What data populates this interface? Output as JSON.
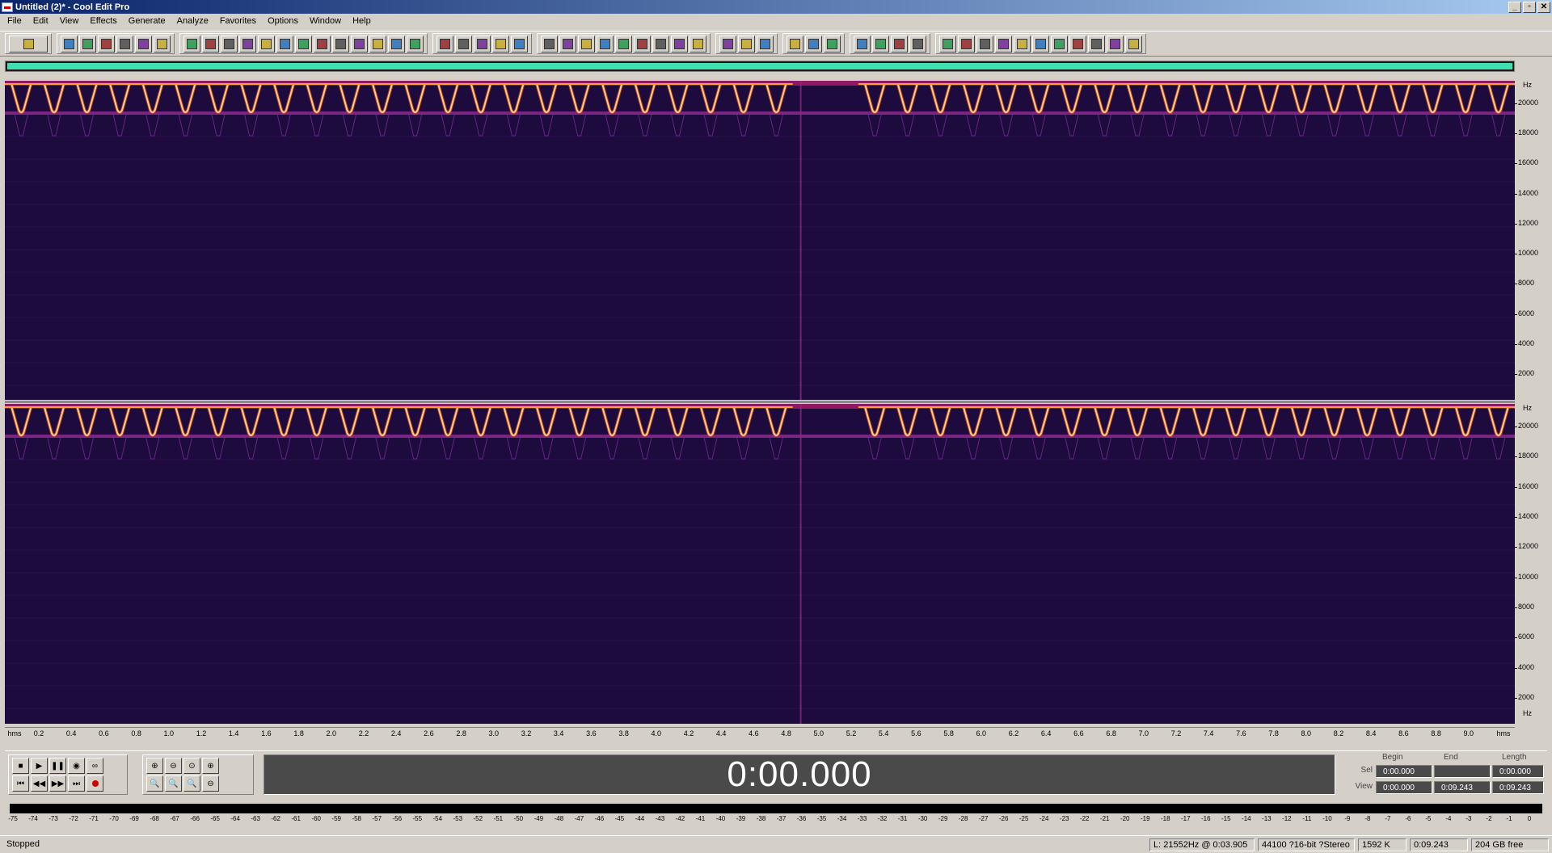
{
  "window": {
    "title": "Untitled (2)* - Cool Edit Pro",
    "buttons": [
      "_",
      "▫",
      "✕"
    ]
  },
  "menu": [
    "File",
    "Edit",
    "View",
    "Effects",
    "Generate",
    "Analyze",
    "Favorites",
    "Options",
    "Window",
    "Help"
  ],
  "toolbar": {
    "groups": [
      1,
      6,
      13,
      5,
      9,
      3,
      3,
      4,
      11
    ]
  },
  "spectral": {
    "freq_unit": "Hz",
    "freq_ticks": [
      "20000",
      "18000",
      "16000",
      "14000",
      "12000",
      "10000",
      "8000",
      "6000",
      "4000",
      "2000"
    ],
    "freq_unit_bottom": "Hz",
    "colors": {
      "background": "#1e0b3e",
      "pulse": "#ffd080",
      "band": "#a030a0"
    },
    "pulses_per_channel": 46,
    "gap_pulse_index": 25
  },
  "time_ruler": {
    "start_label": "hms",
    "end_label": "hms",
    "ticks": [
      "0.2",
      "0.4",
      "0.6",
      "0.8",
      "1.0",
      "1.2",
      "1.4",
      "1.6",
      "1.8",
      "2.0",
      "2.2",
      "2.4",
      "2.6",
      "2.8",
      "3.0",
      "3.2",
      "3.4",
      "3.6",
      "3.8",
      "4.0",
      "4.2",
      "4.4",
      "4.6",
      "4.8",
      "5.0",
      "5.2",
      "5.4",
      "5.6",
      "5.8",
      "6.0",
      "6.2",
      "6.4",
      "6.6",
      "6.8",
      "7.0",
      "7.2",
      "7.4",
      "7.6",
      "7.8",
      "8.0",
      "8.2",
      "8.4",
      "8.6",
      "8.8",
      "9.0"
    ]
  },
  "transport": {
    "time_display": "0:00.000",
    "headers": {
      "begin": "Begin",
      "end": "End",
      "length": "Length"
    },
    "sel": {
      "label": "Sel",
      "begin": "0:00.000",
      "end": "",
      "length": "0:00.000"
    },
    "view": {
      "label": "View",
      "begin": "0:00.000",
      "end": "0:09.243",
      "length": "0:09.243"
    }
  },
  "level_meter": {
    "ticks": [
      "-75",
      "-74",
      "-73",
      "-72",
      "-71",
      "-70",
      "-69",
      "-68",
      "-67",
      "-66",
      "-65",
      "-64",
      "-63",
      "-62",
      "-61",
      "-60",
      "-59",
      "-58",
      "-57",
      "-56",
      "-55",
      "-54",
      "-53",
      "-52",
      "-51",
      "-50",
      "-49",
      "-48",
      "-47",
      "-46",
      "-45",
      "-44",
      "-43",
      "-42",
      "-41",
      "-40",
      "-39",
      "-38",
      "-37",
      "-36",
      "-35",
      "-34",
      "-33",
      "-32",
      "-31",
      "-30",
      "-29",
      "-28",
      "-27",
      "-26",
      "-25",
      "-24",
      "-23",
      "-22",
      "-21",
      "-20",
      "-19",
      "-18",
      "-17",
      "-16",
      "-15",
      "-14",
      "-13",
      "-12",
      "-11",
      "-10",
      "-9",
      "-8",
      "-7",
      "-6",
      "-5",
      "-4",
      "-3",
      "-2",
      "-1",
      "0"
    ]
  },
  "status": {
    "state": "Stopped",
    "cursor": "L: 21552Hz @ 0:03.905",
    "format": "44100 ?16-bit ?Stereo",
    "size": "1592 K",
    "duration": "0:09.243",
    "disk": "204 GB free"
  }
}
